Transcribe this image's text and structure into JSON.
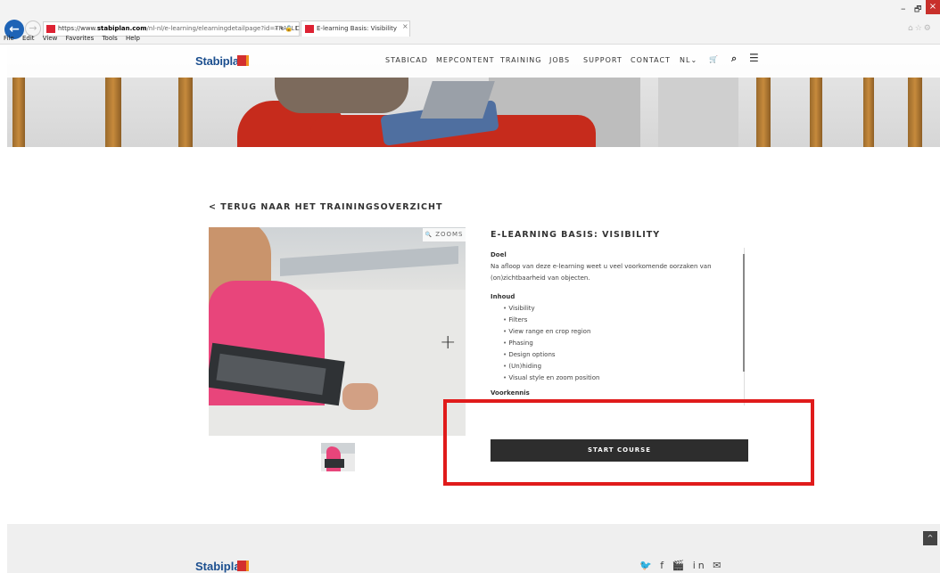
{
  "browser": {
    "url_prefix": "https://www.",
    "url_domain": "stabiplan.com",
    "url_path": "/nl-nl/e-learning/elearningdetailpage?id=TRAEL10010",
    "addr_controls": "⌕ ▾ 🔒 C",
    "tab_title": "E-learning Basis: Visibility",
    "tab_close": "×",
    "menu": [
      "File",
      "Edit",
      "View",
      "Favorites",
      "Tools",
      "Help"
    ],
    "win_min": "–",
    "win_max": "🗗",
    "win_close": "×",
    "back_icon": "←",
    "forward_icon": "→",
    "tool_icons": "⌂☆⚙"
  },
  "site": {
    "logo": "Stabiplan",
    "nav": [
      "STABICAD",
      "MEPCONTENT",
      "TRAINING",
      "JOBS",
      "SUPPORT",
      "CONTACT",
      "NL⌄"
    ],
    "cart_icon": "🛒",
    "search_icon": "⌕",
    "menu_icon": "☰"
  },
  "main": {
    "back_link": "< TERUG NAAR HET TRAININGSOVERZICHT",
    "zoom_label": "ZOOMS",
    "zoom_icon": "🔍",
    "plus": "+",
    "title": "E-LEARNING BASIS: VISIBILITY",
    "doel_heading": "Doel",
    "doel_text": "Na afloop van deze e-learning weet u veel voorkomende oorzaken van (on)zichtbaarheid van objecten.",
    "inhoud_heading": "Inhoud",
    "inhoud_items": [
      "Visibility",
      "Filters",
      "View range en crop region",
      "Phasing",
      "Design options",
      "(Un)hiding",
      "Visual style en zoom position"
    ],
    "voorkennis_heading": "Voorkennis",
    "cta_label": "START COURSE"
  },
  "footer": {
    "logo": "Stabiplan",
    "social": "🐦 f 🎬 in ✉",
    "to_top": "^"
  },
  "colors": {
    "brand_blue": "#1c4f8f",
    "brand_red": "#d32f2f",
    "cta": "#2d2d2d",
    "highlight": "#e01b1b"
  }
}
